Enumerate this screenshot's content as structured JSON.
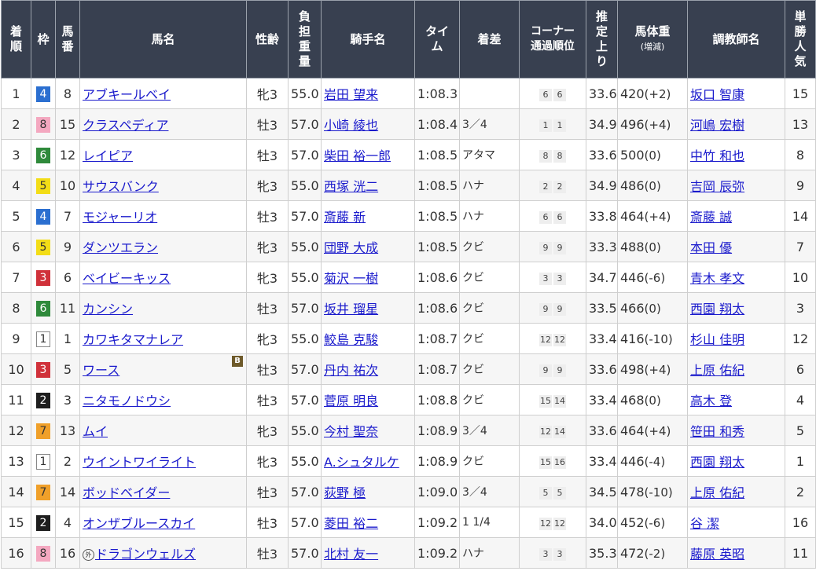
{
  "headers": {
    "rank": "着順",
    "frame": "枠",
    "num": "馬番",
    "horse": "馬名",
    "sexage": "性齢",
    "weight": "負担重量",
    "jockey": "騎手名",
    "time": "タイム",
    "margin": "着差",
    "corner": "コーナー通過順位",
    "last3f": "推定上り",
    "body": "馬体重",
    "body_sub": "(増減)",
    "trainer": "調教師名",
    "pop": "単勝人気"
  },
  "frame_colors": {
    "1": "#ffffff",
    "2": "#1e1e1e",
    "3": "#d0313a",
    "4": "#2b6fd0",
    "5": "#f3dd17",
    "6": "#2f8a3b",
    "7": "#f0a02a",
    "8": "#f4a8c0"
  },
  "blinker_label": "B",
  "foreign_label": "外",
  "rows": [
    {
      "rank": "1",
      "frame": "4",
      "num": "8",
      "horse": "アブキールベイ",
      "sexage": "牝3",
      "weight": "55.0",
      "jockey": "岩田 望来",
      "time": "1:08.3",
      "margin": "",
      "c1": "6",
      "c2": "6",
      "last3f": "33.6",
      "bw": "420",
      "bd": "(+2)",
      "trainer": "坂口 智康",
      "pop": "15"
    },
    {
      "rank": "2",
      "frame": "8",
      "num": "15",
      "horse": "クラスペディア",
      "sexage": "牡3",
      "weight": "57.0",
      "jockey": "小崎 綾也",
      "time": "1:08.4",
      "margin": "3／4",
      "c1": "1",
      "c2": "1",
      "last3f": "34.9",
      "bw": "496",
      "bd": "(+4)",
      "trainer": "河嶋 宏樹",
      "pop": "13"
    },
    {
      "rank": "3",
      "frame": "6",
      "num": "12",
      "horse": "レイピア",
      "sexage": "牡3",
      "weight": "57.0",
      "jockey": "柴田 裕一郎",
      "time": "1:08.5",
      "margin": "アタマ",
      "c1": "8",
      "c2": "8",
      "last3f": "33.6",
      "bw": "500",
      "bd": "(0)",
      "trainer": "中竹 和也",
      "pop": "8"
    },
    {
      "rank": "4",
      "frame": "5",
      "num": "10",
      "horse": "サウスバンク",
      "sexage": "牝3",
      "weight": "55.0",
      "jockey": "西塚 洸二",
      "time": "1:08.5",
      "margin": "ハナ",
      "c1": "2",
      "c2": "2",
      "last3f": "34.9",
      "bw": "486",
      "bd": "(0)",
      "trainer": "吉岡 辰弥",
      "pop": "9"
    },
    {
      "rank": "5",
      "frame": "4",
      "num": "7",
      "horse": "モジャーリオ",
      "sexage": "牡3",
      "weight": "57.0",
      "jockey": "斎藤 新",
      "time": "1:08.5",
      "margin": "ハナ",
      "c1": "6",
      "c2": "6",
      "last3f": "33.8",
      "bw": "464",
      "bd": "(+4)",
      "trainer": "斎藤 誠",
      "pop": "14"
    },
    {
      "rank": "6",
      "frame": "5",
      "num": "9",
      "horse": "ダンツエラン",
      "sexage": "牝3",
      "weight": "55.0",
      "jockey": "団野 大成",
      "time": "1:08.5",
      "margin": "クビ",
      "c1": "9",
      "c2": "9",
      "last3f": "33.3",
      "bw": "488",
      "bd": "(0)",
      "trainer": "本田 優",
      "pop": "7"
    },
    {
      "rank": "7",
      "frame": "3",
      "num": "6",
      "horse": "ベイビーキッス",
      "sexage": "牝3",
      "weight": "55.0",
      "jockey": "菊沢 一樹",
      "time": "1:08.6",
      "margin": "クビ",
      "c1": "3",
      "c2": "3",
      "last3f": "34.7",
      "bw": "446",
      "bd": "(-6)",
      "trainer": "青木 孝文",
      "pop": "10"
    },
    {
      "rank": "8",
      "frame": "6",
      "num": "11",
      "horse": "カンシン",
      "sexage": "牡3",
      "weight": "57.0",
      "jockey": "坂井 瑠星",
      "time": "1:08.6",
      "margin": "クビ",
      "c1": "9",
      "c2": "9",
      "last3f": "33.5",
      "bw": "466",
      "bd": "(0)",
      "trainer": "西園 翔太",
      "pop": "3"
    },
    {
      "rank": "9",
      "frame": "1",
      "num": "1",
      "horse": "カワキタマナレア",
      "sexage": "牝3",
      "weight": "55.0",
      "jockey": "鮫島 克駿",
      "time": "1:08.7",
      "margin": "クビ",
      "c1": "12",
      "c2": "12",
      "last3f": "33.4",
      "bw": "416",
      "bd": "(-10)",
      "trainer": "杉山 佳明",
      "pop": "12"
    },
    {
      "rank": "10",
      "frame": "3",
      "num": "5",
      "horse": "ワース",
      "blinker": true,
      "sexage": "牡3",
      "weight": "57.0",
      "jockey": "丹内 祐次",
      "time": "1:08.7",
      "margin": "クビ",
      "c1": "9",
      "c2": "9",
      "last3f": "33.6",
      "bw": "498",
      "bd": "(+4)",
      "trainer": "上原 佑紀",
      "pop": "6"
    },
    {
      "rank": "11",
      "frame": "2",
      "num": "3",
      "horse": "ニタモノドウシ",
      "sexage": "牡3",
      "weight": "57.0",
      "jockey": "菅原 明良",
      "time": "1:08.8",
      "margin": "クビ",
      "c1": "15",
      "c2": "14",
      "last3f": "33.4",
      "bw": "468",
      "bd": "(0)",
      "trainer": "高木 登",
      "pop": "4"
    },
    {
      "rank": "12",
      "frame": "7",
      "num": "13",
      "horse": "ムイ",
      "sexage": "牝3",
      "weight": "55.0",
      "jockey": "今村 聖奈",
      "time": "1:08.9",
      "margin": "3／4",
      "c1": "12",
      "c2": "14",
      "last3f": "33.6",
      "bw": "464",
      "bd": "(+4)",
      "trainer": "笹田 和秀",
      "pop": "5"
    },
    {
      "rank": "13",
      "frame": "1",
      "num": "2",
      "horse": "ウイントワイライト",
      "sexage": "牝3",
      "weight": "55.0",
      "jockey": "A.シュタルケ",
      "time": "1:08.9",
      "margin": "クビ",
      "c1": "15",
      "c2": "16",
      "last3f": "33.4",
      "bw": "446",
      "bd": "(-4)",
      "trainer": "西園 翔太",
      "pop": "1"
    },
    {
      "rank": "14",
      "frame": "7",
      "num": "14",
      "horse": "ボッドベイダー",
      "sexage": "牡3",
      "weight": "57.0",
      "jockey": "荻野 極",
      "time": "1:09.0",
      "margin": "3／4",
      "c1": "5",
      "c2": "5",
      "last3f": "34.5",
      "bw": "478",
      "bd": "(-10)",
      "trainer": "上原 佑紀",
      "pop": "2"
    },
    {
      "rank": "15",
      "frame": "2",
      "num": "4",
      "horse": "オンザブルースカイ",
      "sexage": "牡3",
      "weight": "57.0",
      "jockey": "菱田 裕二",
      "time": "1:09.2",
      "margin": "1 1/4",
      "c1": "12",
      "c2": "12",
      "last3f": "34.0",
      "bw": "452",
      "bd": "(-6)",
      "trainer": "谷 潔",
      "pop": "16"
    },
    {
      "rank": "16",
      "frame": "8",
      "num": "16",
      "horse": "ドラゴンウェルズ",
      "foreign": true,
      "sexage": "牡3",
      "weight": "57.0",
      "jockey": "北村 友一",
      "time": "1:09.2",
      "margin": "ハナ",
      "c1": "3",
      "c2": "3",
      "last3f": "35.3",
      "bw": "472",
      "bd": "(-2)",
      "trainer": "藤原 英昭",
      "pop": "11"
    }
  ]
}
